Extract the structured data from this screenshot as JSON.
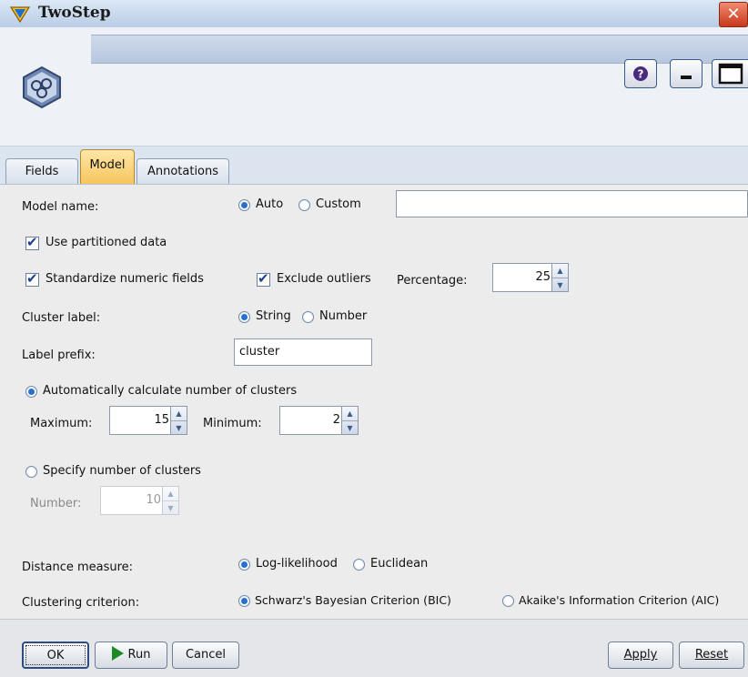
{
  "window": {
    "title": "TwoStep"
  },
  "tabs": [
    {
      "label": "Fields",
      "active": false
    },
    {
      "label": "Model",
      "active": true
    },
    {
      "label": "Annotations",
      "active": false
    }
  ],
  "model_name": {
    "label": "Model name:",
    "options": [
      "Auto",
      "Custom"
    ],
    "selected": "Auto",
    "custom_value": ""
  },
  "use_partitioned": {
    "label": "Use partitioned data",
    "checked": true
  },
  "standardize": {
    "label": "Standardize numeric fields",
    "checked": true
  },
  "exclude_outliers": {
    "label": "Exclude outliers",
    "checked": true
  },
  "percentage": {
    "label": "Percentage:",
    "value": "25"
  },
  "cluster_label": {
    "label": "Cluster label:",
    "options": [
      "String",
      "Number"
    ],
    "selected": "String"
  },
  "label_prefix": {
    "label": "Label prefix:",
    "value": "cluster"
  },
  "auto_clusters": {
    "label": "Automatically calculate number of clusters",
    "selected": true,
    "maximum_label": "Maximum:",
    "maximum": "15",
    "minimum_label": "Minimum:",
    "minimum": "2"
  },
  "specify_clusters": {
    "label": "Specify number of clusters",
    "selected": false,
    "number_label": "Number:",
    "number": "10"
  },
  "distance_measure": {
    "label": "Distance measure:",
    "options": [
      "Log-likelihood",
      "Euclidean"
    ],
    "selected": "Log-likelihood"
  },
  "clustering_criterion": {
    "label": "Clustering criterion:",
    "options": [
      "Schwarz's Bayesian Criterion (BIC)",
      "Akaike's Information Criterion (AIC)"
    ],
    "selected": "Schwarz's Bayesian Criterion (BIC)"
  },
  "footer": {
    "ok": "OK",
    "run": "Run",
    "cancel": "Cancel",
    "apply": "Apply",
    "reset": "Reset"
  },
  "icons": {
    "app": "twostep-node-icon",
    "help": "help-icon",
    "minimize": "minimize-icon",
    "maximize": "maximize-icon",
    "close": "close-icon",
    "run": "play-icon"
  },
  "colors": {
    "active_tab": "#f6c45a",
    "radio_selected": "#2a6fc9",
    "check_mark": "#1e3f92",
    "run_icon": "#1c8a25",
    "close_button": "#c9381b"
  }
}
